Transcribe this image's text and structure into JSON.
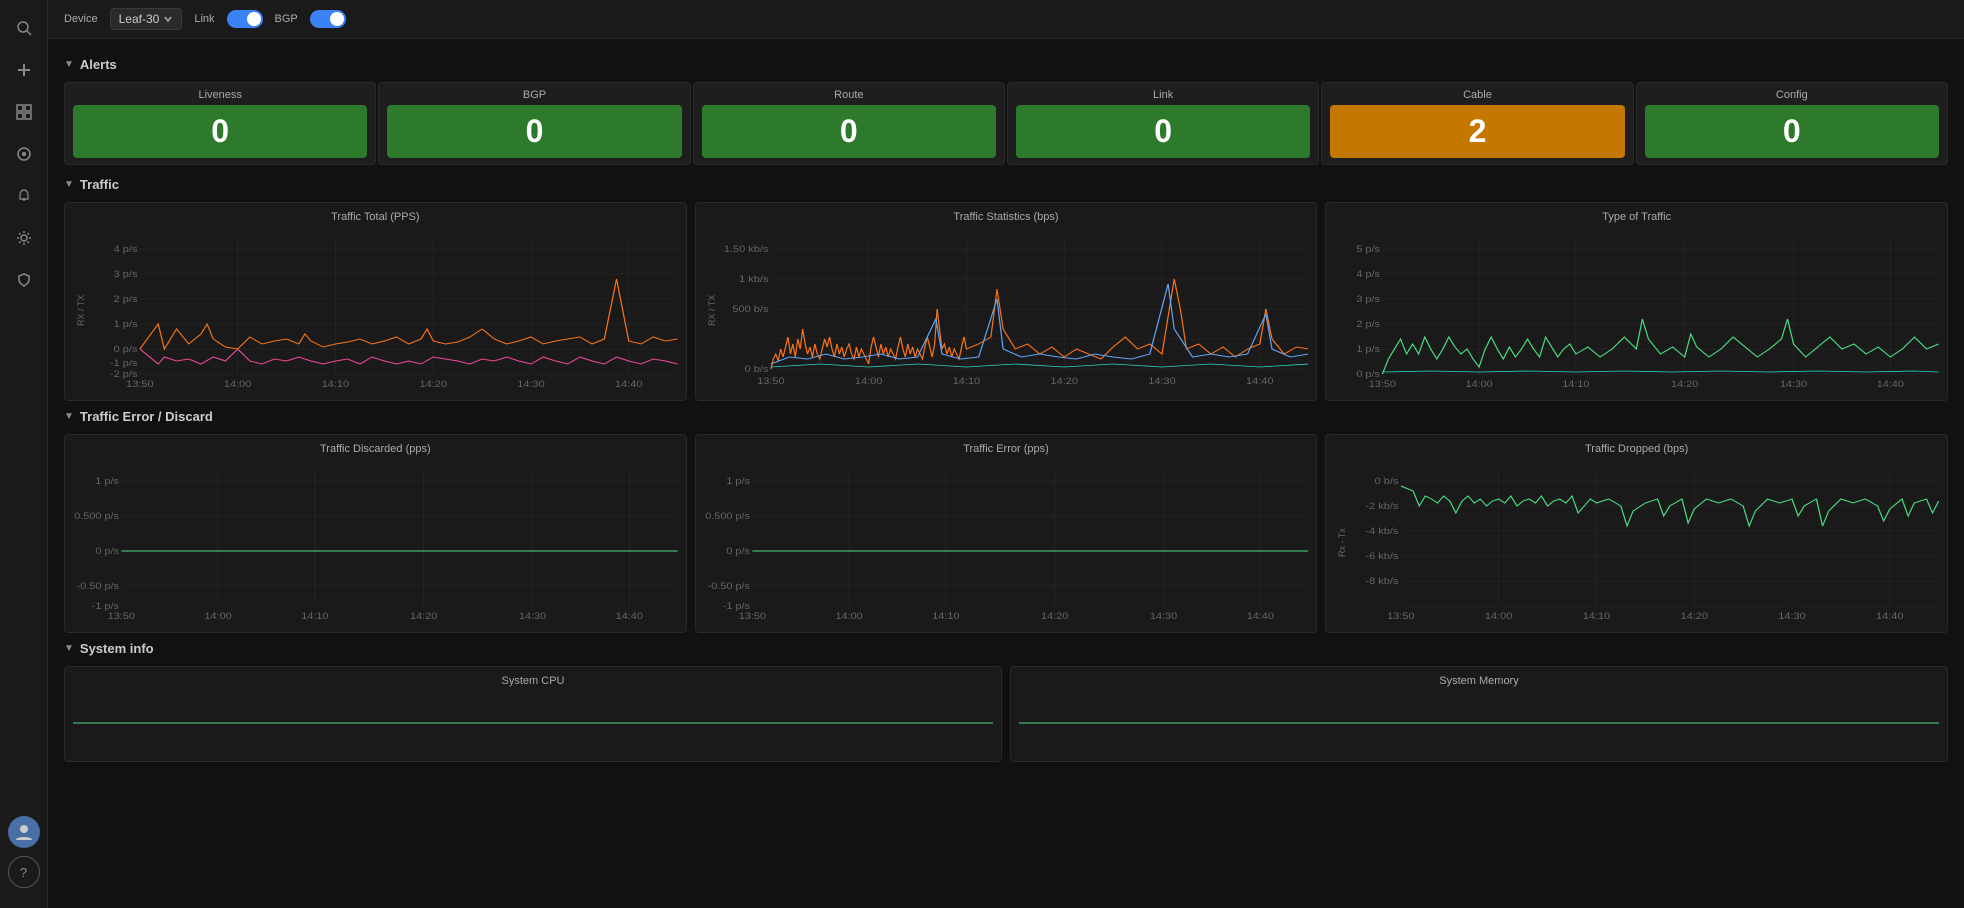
{
  "toolbar": {
    "device_label": "Device",
    "device_value": "Leaf-30",
    "link_label": "Link",
    "bgp_label": "BGP"
  },
  "alerts": {
    "section_title": "Alerts",
    "cards": [
      {
        "label": "Liveness",
        "value": "0",
        "color": "green"
      },
      {
        "label": "BGP",
        "value": "0",
        "color": "green"
      },
      {
        "label": "Route",
        "value": "0",
        "color": "green"
      },
      {
        "label": "Link",
        "value": "0",
        "color": "green"
      },
      {
        "label": "Cable",
        "value": "2",
        "color": "orange"
      },
      {
        "label": "Config",
        "value": "0",
        "color": "green"
      }
    ]
  },
  "traffic_section": {
    "title": "Traffic",
    "charts": [
      {
        "title": "Traffic Total (PPS)",
        "y_label": "RX / TX"
      },
      {
        "title": "Traffic Statistics (bps)",
        "y_label": "RX / TX"
      },
      {
        "title": "Type of Traffic",
        "y_label": ""
      }
    ]
  },
  "traffic_error_section": {
    "title": "Traffic Error / Discard",
    "charts": [
      {
        "title": "Traffic Discarded (pps)",
        "y_label": ""
      },
      {
        "title": "Traffic Error (pps)",
        "y_label": ""
      },
      {
        "title": "Traffic Dropped (bps)",
        "y_label": "Rx - Tx"
      }
    ]
  },
  "system_info_section": {
    "title": "System info",
    "charts": [
      {
        "title": "System CPU"
      },
      {
        "title": "System Memory"
      }
    ]
  },
  "x_axis_labels": [
    "13:50",
    "14:00",
    "14:10",
    "14:20",
    "14:30",
    "14:40"
  ],
  "sidebar_icons": [
    {
      "name": "search-icon",
      "glyph": "🔍"
    },
    {
      "name": "plus-icon",
      "glyph": "+"
    },
    {
      "name": "grid-icon",
      "glyph": "⊞"
    },
    {
      "name": "compass-icon",
      "glyph": "◎"
    },
    {
      "name": "bell-icon",
      "glyph": "🔔"
    },
    {
      "name": "gear-icon",
      "glyph": "⚙"
    },
    {
      "name": "shield-icon",
      "glyph": "🛡"
    }
  ],
  "colors": {
    "accent_blue": "#3b82f6",
    "green_alert": "#2d7a2d",
    "orange_alert": "#c47800",
    "chart_orange": "#f97316",
    "chart_blue": "#60a5fa",
    "chart_pink": "#ec4899",
    "chart_green": "#4ade80",
    "chart_teal": "#2dd4bf"
  }
}
